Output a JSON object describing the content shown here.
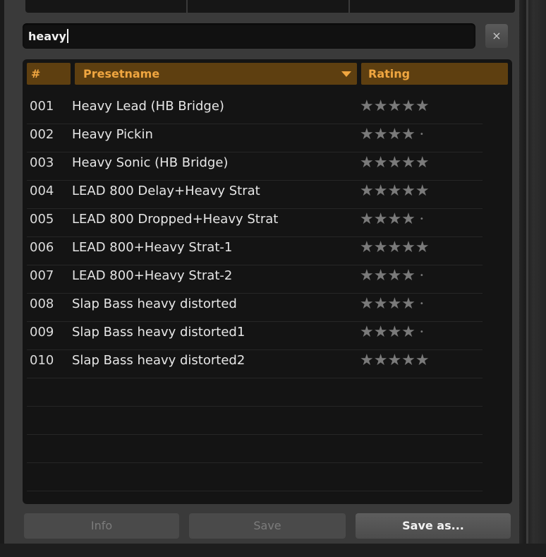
{
  "search": {
    "value": "heavy",
    "clear_label": "×"
  },
  "columns": {
    "number": "#",
    "name": "Presetname",
    "rating": "Rating"
  },
  "presets": [
    {
      "number": "001",
      "name": "Heavy Lead  (HB Bridge)",
      "rating": 5,
      "stars": "★★★★★"
    },
    {
      "number": "002",
      "name": "Heavy Pickin",
      "rating": 4,
      "stars": "★★★★"
    },
    {
      "number": "003",
      "name": "Heavy Sonic (HB Bridge)",
      "rating": 5,
      "stars": "★★★★★"
    },
    {
      "number": "004",
      "name": "LEAD 800 Delay+Heavy Strat",
      "rating": 5,
      "stars": "★★★★★"
    },
    {
      "number": "005",
      "name": "LEAD 800 Dropped+Heavy Strat",
      "rating": 4,
      "stars": "★★★★"
    },
    {
      "number": "006",
      "name": "LEAD 800+Heavy Strat-1",
      "rating": 5,
      "stars": "★★★★★"
    },
    {
      "number": "007",
      "name": "LEAD 800+Heavy Strat-2",
      "rating": 4,
      "stars": "★★★★"
    },
    {
      "number": "008",
      "name": "Slap Bass heavy distorted",
      "rating": 4,
      "stars": "★★★★"
    },
    {
      "number": "009",
      "name": "Slap Bass heavy distorted1",
      "rating": 4,
      "stars": "★★★★"
    },
    {
      "number": "010",
      "name": "Slap Bass heavy distorted2",
      "rating": 5,
      "stars": "★★★★★"
    }
  ],
  "buttons": {
    "info": "Info",
    "save": "Save",
    "save_as": "Save as..."
  },
  "colors": {
    "header_bg": "#5e3f10",
    "header_text": "#f0a640",
    "star": "#7a7a7a"
  }
}
